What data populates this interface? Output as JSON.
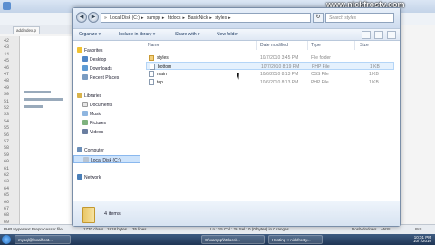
{
  "editor": {
    "tab_label": "addindex.p",
    "line_numbers": [
      "42",
      "43",
      "44",
      "45",
      "46",
      "47",
      "48",
      "49",
      "50",
      "51",
      "52",
      "53",
      "54",
      "55",
      "56",
      "57",
      "58",
      "59",
      "60",
      "61",
      "62",
      "63",
      "64",
      "65",
      "66",
      "67",
      "68",
      "69"
    ],
    "status": {
      "file_type": "PHP Hypertext Preprocessor file",
      "chars": "1770 chars",
      "bytes": "1818 bytes",
      "lines": "35 lines",
      "position": "Ln : 15    Col : 26    Sel : 0 (0 bytes) in 0 ranges",
      "eol": "Dos\\Windows",
      "encoding": "ANSI",
      "mode": "INS"
    }
  },
  "watermark": "www.nickfrosty.com",
  "dialog": {
    "breadcrumbs": [
      "Local Disk (C:)",
      "xampp",
      "htdocs",
      "BasicNick",
      "styles"
    ],
    "search_placeholder": "Search styles",
    "toolbar": {
      "organize": "Organize ▾",
      "include": "Include in library ▾",
      "share": "Share with ▾",
      "new_folder": "New folder"
    },
    "nav": {
      "favorites": "Favorites",
      "desktop": "Desktop",
      "downloads": "Downloads",
      "recent": "Recent Places",
      "libraries": "Libraries",
      "documents": "Documents",
      "music": "Music",
      "pictures": "Pictures",
      "videos": "Videos",
      "computer": "Computer",
      "local_disk": "Local Disk (C:)",
      "network": "Network"
    },
    "columns": {
      "name": "Name",
      "date": "Date modified",
      "type": "Type",
      "size": "Size"
    },
    "files": [
      {
        "name": "styles",
        "date": "10/7/2010 3:45 PM",
        "type": "File folder",
        "size": ""
      },
      {
        "name": "bottom",
        "date": "10/7/2010 8:19 PM",
        "type": "PHP File",
        "size": "1 KB"
      },
      {
        "name": "main",
        "date": "10/6/2010 8:13 PM",
        "type": "CSS File",
        "size": "1 KB"
      },
      {
        "name": "top",
        "date": "10/6/2010 8:13 PM",
        "type": "PHP File",
        "size": "1 KB"
      }
    ],
    "items_count": "4 items"
  },
  "taskbar": {
    "tasks": [
      "mysql@localhost...",
      "C:\\xampp\\htdocs\\...",
      "Hosting :: nickfrosty..."
    ],
    "time": "10:01 PM",
    "date": "10/7/2010"
  },
  "colors": {
    "selection": "#cde3fb",
    "taskbar": "#1f3554",
    "watermark": "#ffffff"
  }
}
